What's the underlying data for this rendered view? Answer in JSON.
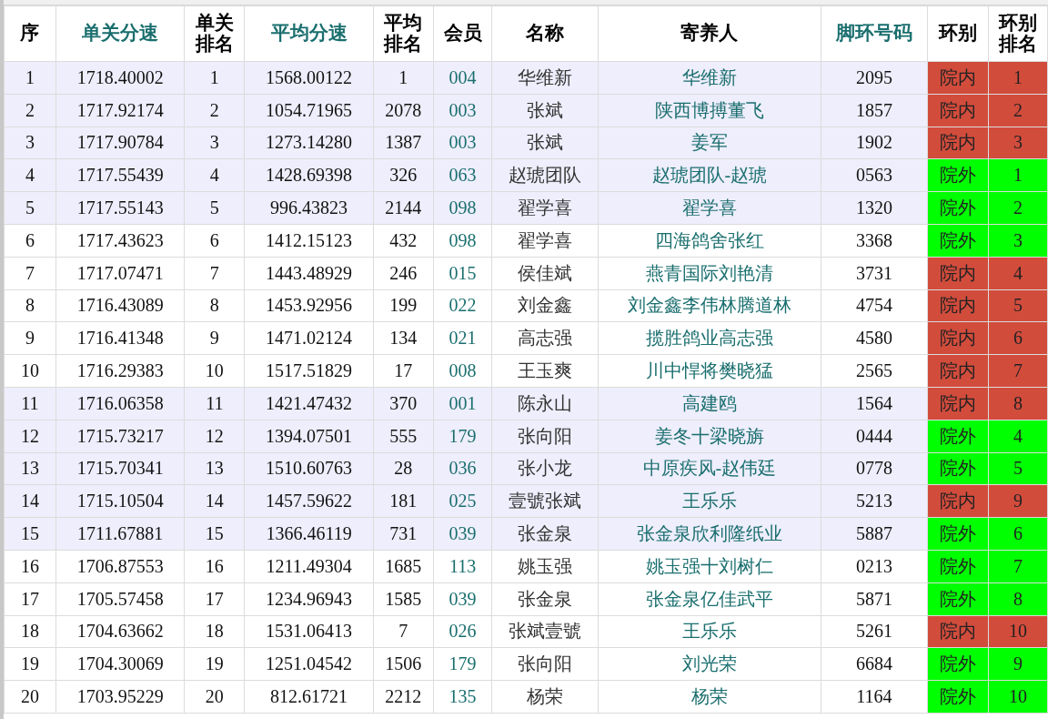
{
  "table": {
    "columns": [
      {
        "label": "序",
        "color": "#000000"
      },
      {
        "label": "单关分速",
        "color": "#1a6e6e"
      },
      {
        "label": "单关排名",
        "color": "#000000"
      },
      {
        "label": "平均分速",
        "color": "#1a6e6e"
      },
      {
        "label": "平均排名",
        "color": "#000000"
      },
      {
        "label": "会员",
        "color": "#000000"
      },
      {
        "label": "名称",
        "color": "#000000"
      },
      {
        "label": "寄养人",
        "color": "#000000"
      },
      {
        "label": "脚环号码",
        "color": "#1a6e6e"
      },
      {
        "label": "环别",
        "color": "#000000"
      },
      {
        "label": "环别排名",
        "color": "#000000"
      }
    ],
    "rows": [
      {
        "cells": [
          "1",
          "1718.40002",
          "1",
          "1568.00122",
          "1",
          "004",
          "华维新",
          "华维新",
          "2095",
          "院内",
          "1"
        ],
        "color": "#d24c3c"
      },
      {
        "cells": [
          "2",
          "1717.92174",
          "2",
          "1054.71965",
          "2078",
          "003",
          "张斌",
          "陕西博搏董飞",
          "1857",
          "院内",
          "2"
        ],
        "color": "#d24c3c"
      },
      {
        "cells": [
          "3",
          "1717.90784",
          "3",
          "1273.14280",
          "1387",
          "003",
          "张斌",
          "姜军",
          "1902",
          "院内",
          "3"
        ],
        "color": "#d24c3c"
      },
      {
        "cells": [
          "4",
          "1717.55439",
          "4",
          "1428.69398",
          "326",
          "063",
          "赵琥团队",
          "赵琥团队-赵琥",
          "0563",
          "院外",
          "1"
        ],
        "color": "#00ff00"
      },
      {
        "cells": [
          "5",
          "1717.55143",
          "5",
          "996.43823",
          "2144",
          "098",
          "翟学喜",
          "翟学喜",
          "1320",
          "院外",
          "2"
        ],
        "color": "#00ff00"
      },
      {
        "cells": [
          "6",
          "1717.43623",
          "6",
          "1412.15123",
          "432",
          "098",
          "翟学喜",
          "四海鸽舍张红",
          "3368",
          "院外",
          "3"
        ],
        "color": "#00ff00"
      },
      {
        "cells": [
          "7",
          "1717.07471",
          "7",
          "1443.48929",
          "246",
          "015",
          "侯佳斌",
          "燕青国际刘艳清",
          "3731",
          "院内",
          "4"
        ],
        "color": "#d24c3c"
      },
      {
        "cells": [
          "8",
          "1716.43089",
          "8",
          "1453.92956",
          "199",
          "022",
          "刘金鑫",
          "刘金鑫李伟林腾道林",
          "4754",
          "院内",
          "5"
        ],
        "color": "#d24c3c"
      },
      {
        "cells": [
          "9",
          "1716.41348",
          "9",
          "1471.02124",
          "134",
          "021",
          "高志强",
          "揽胜鸽业高志强",
          "4580",
          "院内",
          "6"
        ],
        "color": "#d24c3c"
      },
      {
        "cells": [
          "10",
          "1716.29383",
          "10",
          "1517.51829",
          "17",
          "008",
          "王玉爽",
          "川中悍将樊晓猛",
          "2565",
          "院内",
          "7"
        ],
        "color": "#d24c3c"
      },
      {
        "cells": [
          "11",
          "1716.06358",
          "11",
          "1421.47432",
          "370",
          "001",
          "陈永山",
          "高建鸥",
          "1564",
          "院内",
          "8"
        ],
        "color": "#d24c3c"
      },
      {
        "cells": [
          "12",
          "1715.73217",
          "12",
          "1394.07501",
          "555",
          "179",
          "张向阳",
          "姜冬十梁晓旃",
          "0444",
          "院外",
          "4"
        ],
        "color": "#00ff00"
      },
      {
        "cells": [
          "13",
          "1715.70341",
          "13",
          "1510.60763",
          "28",
          "036",
          "张小龙",
          "中原疾风-赵伟廷",
          "0778",
          "院外",
          "5"
        ],
        "color": "#00ff00"
      },
      {
        "cells": [
          "14",
          "1715.10504",
          "14",
          "1457.59622",
          "181",
          "025",
          "壹號张斌",
          "王乐乐",
          "5213",
          "院内",
          "9"
        ],
        "color": "#d24c3c"
      },
      {
        "cells": [
          "15",
          "1711.67881",
          "15",
          "1366.46119",
          "731",
          "039",
          "张金泉",
          "张金泉欣利隆纸业",
          "5887",
          "院外",
          "6"
        ],
        "color": "#00ff00"
      },
      {
        "cells": [
          "16",
          "1706.87553",
          "16",
          "1211.49304",
          "1685",
          "113",
          "姚玉强",
          "姚玉强十刘树仁",
          "0213",
          "院外",
          "7"
        ],
        "color": "#00ff00"
      },
      {
        "cells": [
          "17",
          "1705.57458",
          "17",
          "1234.96943",
          "1585",
          "039",
          "张金泉",
          "张金泉亿佳武平",
          "5871",
          "院外",
          "8"
        ],
        "color": "#00ff00"
      },
      {
        "cells": [
          "18",
          "1704.63662",
          "18",
          "1531.06413",
          "7",
          "026",
          "张斌壹號",
          "王乐乐",
          "5261",
          "院内",
          "10"
        ],
        "color": "#d24c3c"
      },
      {
        "cells": [
          "19",
          "1704.30069",
          "19",
          "1251.04542",
          "1506",
          "179",
          "张向阳",
          "刘光荣",
          "6684",
          "院外",
          "9"
        ],
        "color": "#00ff00"
      },
      {
        "cells": [
          "20",
          "1703.95229",
          "20",
          "812.61721",
          "2212",
          "135",
          "杨荣",
          "杨荣",
          "1164",
          "院外",
          "10"
        ],
        "color": "#00ff00"
      }
    ]
  }
}
